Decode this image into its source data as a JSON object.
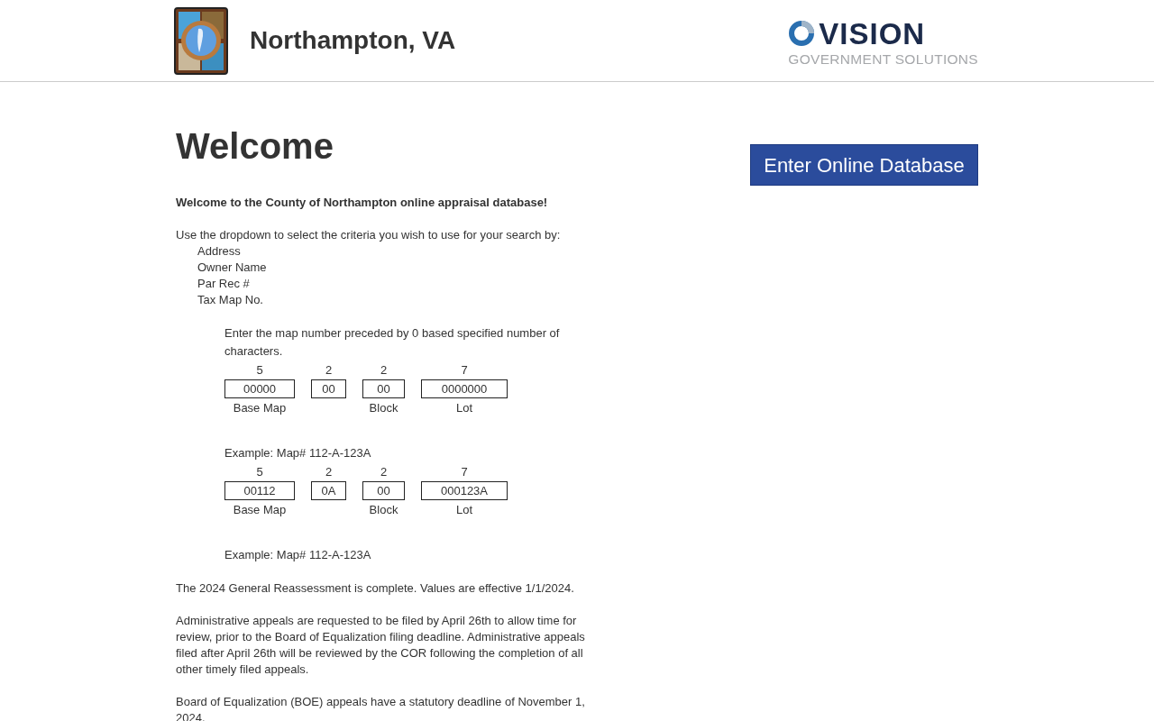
{
  "header": {
    "title": "Northampton, VA",
    "partner_logo": {
      "name": "VISION",
      "tagline": "GOVERNMENT SOLUTIONS"
    }
  },
  "welcome": {
    "heading": "Welcome",
    "intro": "Welcome to the County of Northampton online appraisal database!",
    "instructions": "Use the dropdown to select the criteria you wish to use for your search by:",
    "criteria": [
      "Address",
      "Owner Name",
      "Par Rec #",
      "Tax Map No."
    ],
    "map_help": [
      {
        "kind": "text",
        "text": "Enter the map number preceded by 0 based specified number of characters."
      },
      {
        "kind": "grid",
        "segments": [
          {
            "length": "5",
            "value": "00000",
            "label": "Base Map"
          },
          {
            "length": "2",
            "value": "00"
          },
          {
            "length": "2",
            "value": "00",
            "label": "Block"
          },
          {
            "length": "7",
            "value": "0000000",
            "label": "Lot"
          }
        ]
      },
      {
        "kind": "text",
        "text": "Example: Map# 112-A-123A"
      },
      {
        "kind": "grid",
        "segments": [
          {
            "length": "5",
            "value": "00112",
            "label": "Base Map"
          },
          {
            "length": "2",
            "value": "0A"
          },
          {
            "length": "2",
            "value": "00",
            "label": "Block"
          },
          {
            "length": "7",
            "value": "000123A",
            "label": "Lot"
          }
        ]
      },
      {
        "kind": "text",
        "text": "Example: Map# 112-A-123A"
      }
    ],
    "paragraphs": [
      "The 2024 General Reassessment is complete. Values are effective 1/1/2024.",
      "Administrative appeals are requested to be filed by April 26th to allow time for review, prior to the Board of Equalization filing deadline.  Administrative appeals filed after April 26th will be reviewed by the COR following the completion of all other timely filed appeals.",
      "Board of Equalization (BOE) appeals have a statutory deadline of November 1, 2024."
    ]
  },
  "enter_button": "Enter Online Database"
}
